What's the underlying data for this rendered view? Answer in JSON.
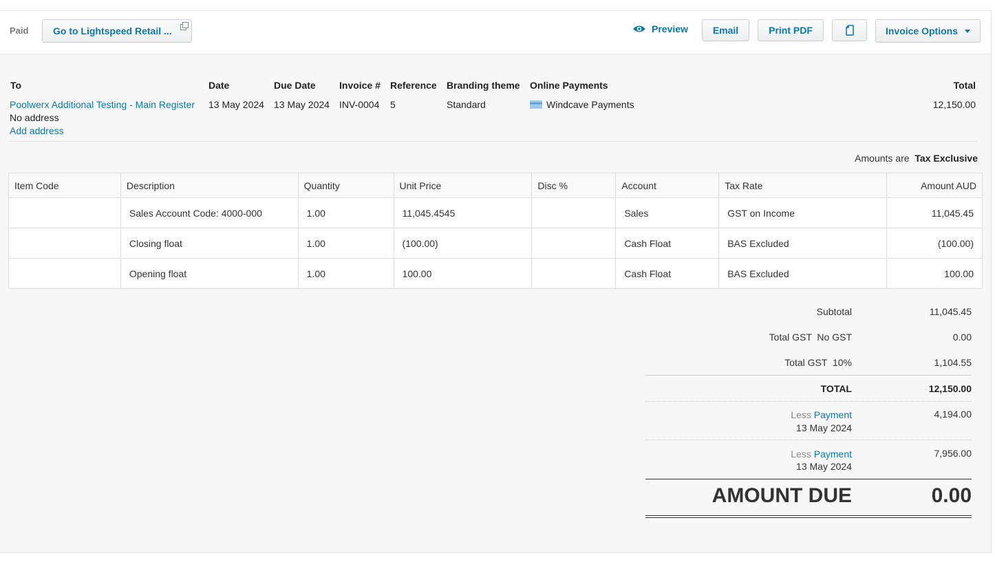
{
  "toolbar": {
    "status": "Paid",
    "goto_label": "Go to Lightspeed Retail ...",
    "preview_label": "Preview",
    "email_label": "Email",
    "print_label": "Print PDF",
    "options_label": "Invoice Options"
  },
  "invoice": {
    "headers": {
      "to": "To",
      "date": "Date",
      "due_date": "Due Date",
      "invoice_no": "Invoice #",
      "reference": "Reference",
      "branding": "Branding theme",
      "online": "Online Payments",
      "total": "Total"
    },
    "to_name": "Poolwerx Additional Testing - Main Register",
    "no_address": "No address",
    "add_address": "Add address",
    "date": "13 May 2024",
    "due_date": "13 May 2024",
    "invoice_no": "INV-0004",
    "reference": "5",
    "branding": "Standard",
    "online_payment": "Windcave Payments",
    "total": "12,150.00"
  },
  "tax_note": {
    "label": "Amounts are",
    "value": "Tax Exclusive"
  },
  "table": {
    "columns": [
      "Item Code",
      "Description",
      "Quantity",
      "Unit Price",
      "Disc %",
      "Account",
      "Tax Rate",
      "Amount AUD"
    ],
    "rows": [
      {
        "item_code": "",
        "description": "Sales Account Code: 4000-000",
        "quantity": "1.00",
        "unit_price": "11,045.4545",
        "disc": "",
        "account": "Sales",
        "tax_rate": "GST on Income",
        "amount": "11,045.45"
      },
      {
        "item_code": "",
        "description": "Closing float",
        "quantity": "1.00",
        "unit_price": "(100.00)",
        "disc": "",
        "account": "Cash Float",
        "tax_rate": "BAS Excluded",
        "amount": "(100.00)"
      },
      {
        "item_code": "",
        "description": "Opening float",
        "quantity": "1.00",
        "unit_price": "100.00",
        "disc": "",
        "account": "Cash Float",
        "tax_rate": "BAS Excluded",
        "amount": "100.00"
      }
    ]
  },
  "totals": {
    "subtotal_label": "Subtotal",
    "subtotal": "11,045.45",
    "gst_nogst_label": "Total GST  No GST",
    "gst_nogst": "0.00",
    "gst_10_label": "Total GST  10%",
    "gst_10": "1,104.55",
    "total_label": "TOTAL",
    "total": "12,150.00",
    "payments": [
      {
        "less": "Less",
        "link": "Payment",
        "date": "13 May 2024",
        "amount": "4,194.00"
      },
      {
        "less": "Less",
        "link": "Payment",
        "date": "13 May 2024",
        "amount": "7,956.00"
      }
    ],
    "amount_due_label": "AMOUNT DUE",
    "amount_due": "0.00"
  }
}
